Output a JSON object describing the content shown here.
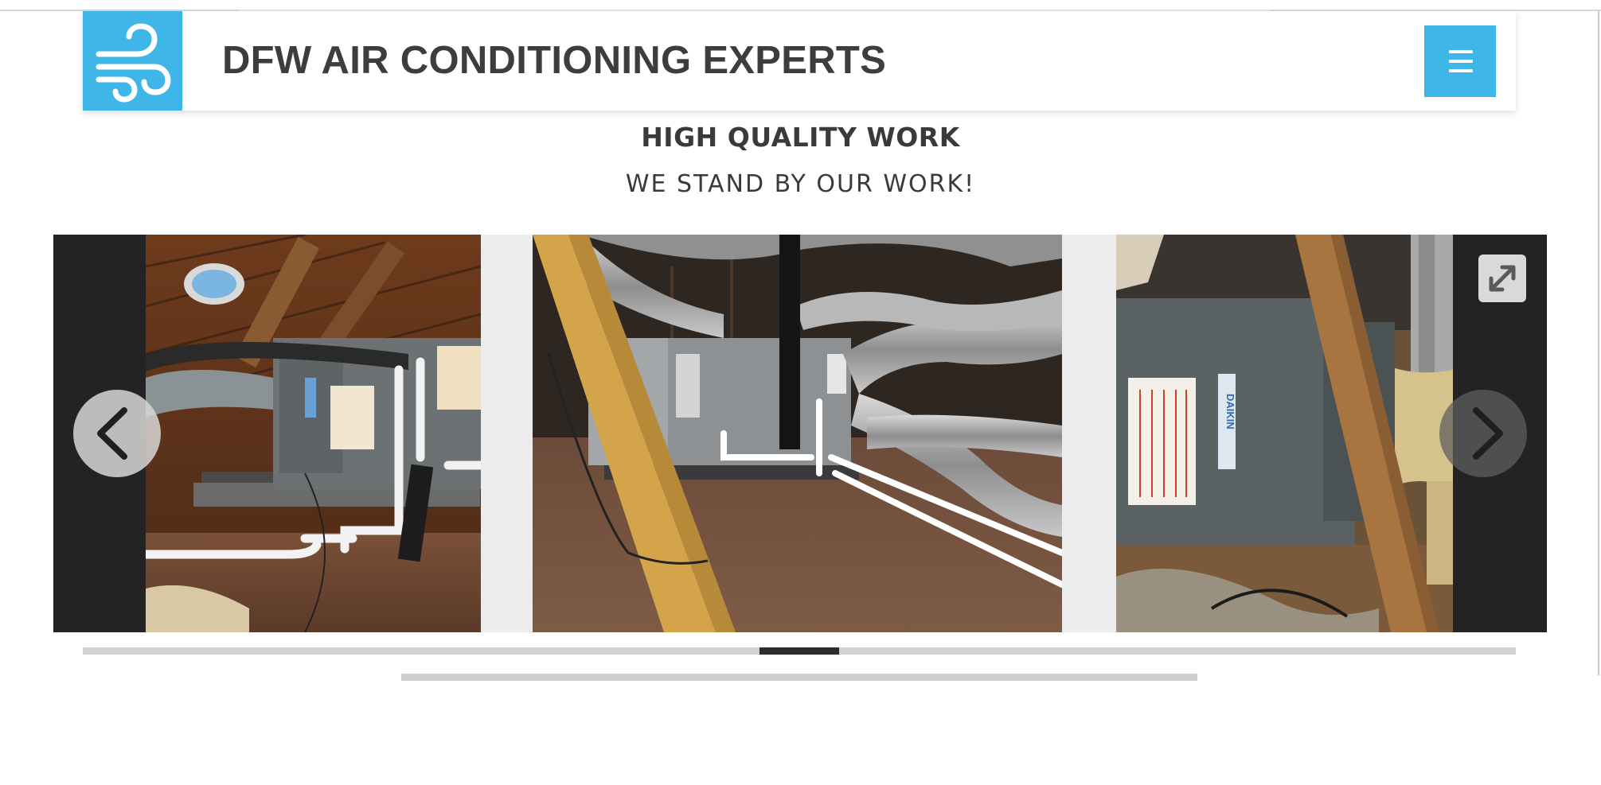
{
  "brand": {
    "site_title": "DFW AIR CONDITIONING EXPERTS",
    "logo_icon": "wind-icon",
    "accent_color": "#3fb6e8"
  },
  "header": {
    "menu_icon": "hamburger-menu-icon"
  },
  "hero": {
    "title": "HIGH QUALITY WORK",
    "subtitle": "WE STAND BY OUR WORK!"
  },
  "gallery": {
    "photos": [
      {
        "subject": "attic-air-handler-with-pvc-drain-lines"
      },
      {
        "subject": "attic-air-handler-with-flex-ducts"
      },
      {
        "subject": "daikin-furnace-unit-in-attic"
      }
    ],
    "prev_icon": "chevron-left-icon",
    "next_icon": "chevron-right-icon",
    "fullscreen_icon": "expand-arrows-icon",
    "progress": 0.5
  }
}
